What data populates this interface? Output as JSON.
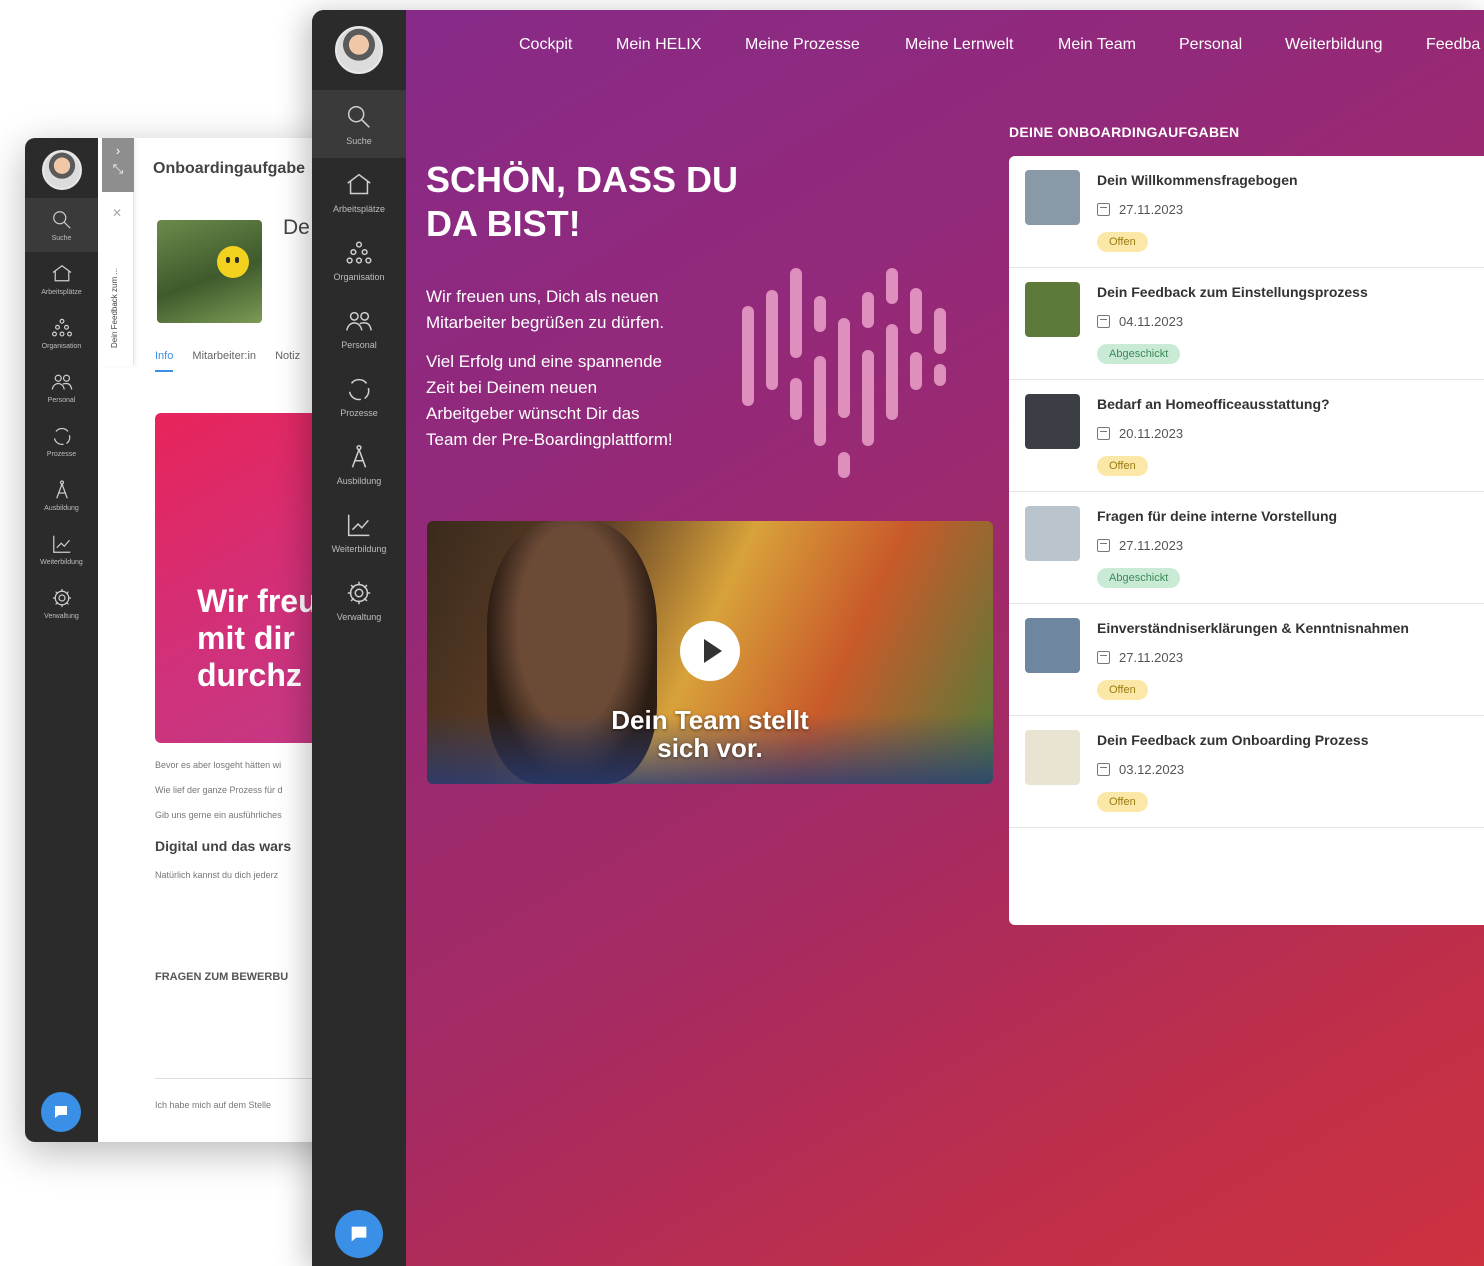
{
  "back_window": {
    "nav": [
      {
        "label": "Suche",
        "icon": "search-icon"
      },
      {
        "label": "Arbeitsplätze",
        "icon": "home-icon"
      },
      {
        "label": "Organisation",
        "icon": "org-chart-icon"
      },
      {
        "label": "Personal",
        "icon": "people-icon"
      },
      {
        "label": "Prozesse",
        "icon": "cycle-icon"
      },
      {
        "label": "Ausbildung",
        "icon": "compass-icon"
      },
      {
        "label": "Weiterbildung",
        "icon": "growth-chart-icon"
      },
      {
        "label": "Verwaltung",
        "icon": "gear-icon"
      }
    ],
    "side_tab_label": "Dein Feedback zum ...",
    "title": "Onboardingaufgabe",
    "heading_partial": "De",
    "tabs": [
      "Info",
      "Mitarbeiter:in",
      "Notiz"
    ],
    "promo_text": "Wir freu\nmit dir\ndurchz",
    "paragraphs": [
      "Bevor es aber losgeht hätten wi",
      "Wie lief der ganze Prozess für d",
      "Gib uns gerne ein ausführliches"
    ],
    "subheading": "Digital und das wars",
    "subtext": "Natürlich kannst du dich jederz",
    "section_heading": "FRAGEN ZUM BEWERBU",
    "input_value": "Ich habe mich auf dem Stelle"
  },
  "front_window": {
    "nav": [
      {
        "label": "Suche",
        "icon": "search-icon"
      },
      {
        "label": "Arbeitsplätze",
        "icon": "home-icon"
      },
      {
        "label": "Organisation",
        "icon": "org-chart-icon"
      },
      {
        "label": "Personal",
        "icon": "people-icon"
      },
      {
        "label": "Prozesse",
        "icon": "cycle-icon"
      },
      {
        "label": "Ausbildung",
        "icon": "compass-icon"
      },
      {
        "label": "Weiterbildung",
        "icon": "growth-chart-icon"
      },
      {
        "label": "Verwaltung",
        "icon": "gear-icon"
      }
    ],
    "topnav": [
      "Cockpit",
      "Mein HELIX",
      "Meine Prozesse",
      "Meine Lernwelt",
      "Mein Team",
      "Personal",
      "Weiterbildung",
      "Feedba"
    ],
    "hero_title": "SCHÖN, DASS DU\nDA BIST!",
    "hero_p1": "Wir freuen uns, Dich als neuen\nMitarbeiter begrüßen zu dürfen.",
    "hero_p2": "Viel Erfolg und eine spannende\nZeit bei Deinem neuen\nArbeitgeber wünscht Dir das\nTeam der Pre-Boardingplattform!",
    "video_caption": "Dein Team stellt\nsich vor.",
    "tasks_heading": "DEINE ONBOARDINGAUFGABEN",
    "tasks": [
      {
        "title": "Dein Willkommensfragebogen",
        "date": "27.11.2023",
        "status": "Offen",
        "status_kind": "open",
        "thumb_color": "#8a99a8"
      },
      {
        "title": "Dein Feedback zum Einstellungsprozess",
        "date": "04.11.2023",
        "status": "Abgeschickt",
        "status_kind": "sent",
        "thumb_color": "#5d7a3a"
      },
      {
        "title": "Bedarf an Homeofficeausstattung?",
        "date": "20.11.2023",
        "status": "Offen",
        "status_kind": "open",
        "thumb_color": "#3b3e44"
      },
      {
        "title": "Fragen für deine interne Vorstellung",
        "date": "27.11.2023",
        "status": "Abgeschickt",
        "status_kind": "sent",
        "thumb_color": "#b9c4cc"
      },
      {
        "title": "Einverständniserklärungen & Kenntnisnahmen",
        "date": "27.11.2023",
        "status": "Offen",
        "status_kind": "open",
        "thumb_color": "#6f86a0"
      },
      {
        "title": "Dein Feedback zum Onboarding Prozess",
        "date": "03.12.2023",
        "status": "Offen",
        "status_kind": "open",
        "thumb_color": "#e9e4d2"
      }
    ]
  },
  "colors": {
    "sidebar": "#2b2b2b",
    "chat_button": "#3a8fe6",
    "badge_open": "#fbe8a6",
    "badge_sent": "#c9ead5",
    "gradient_start": "#862a8a",
    "gradient_end": "#cc3240"
  }
}
